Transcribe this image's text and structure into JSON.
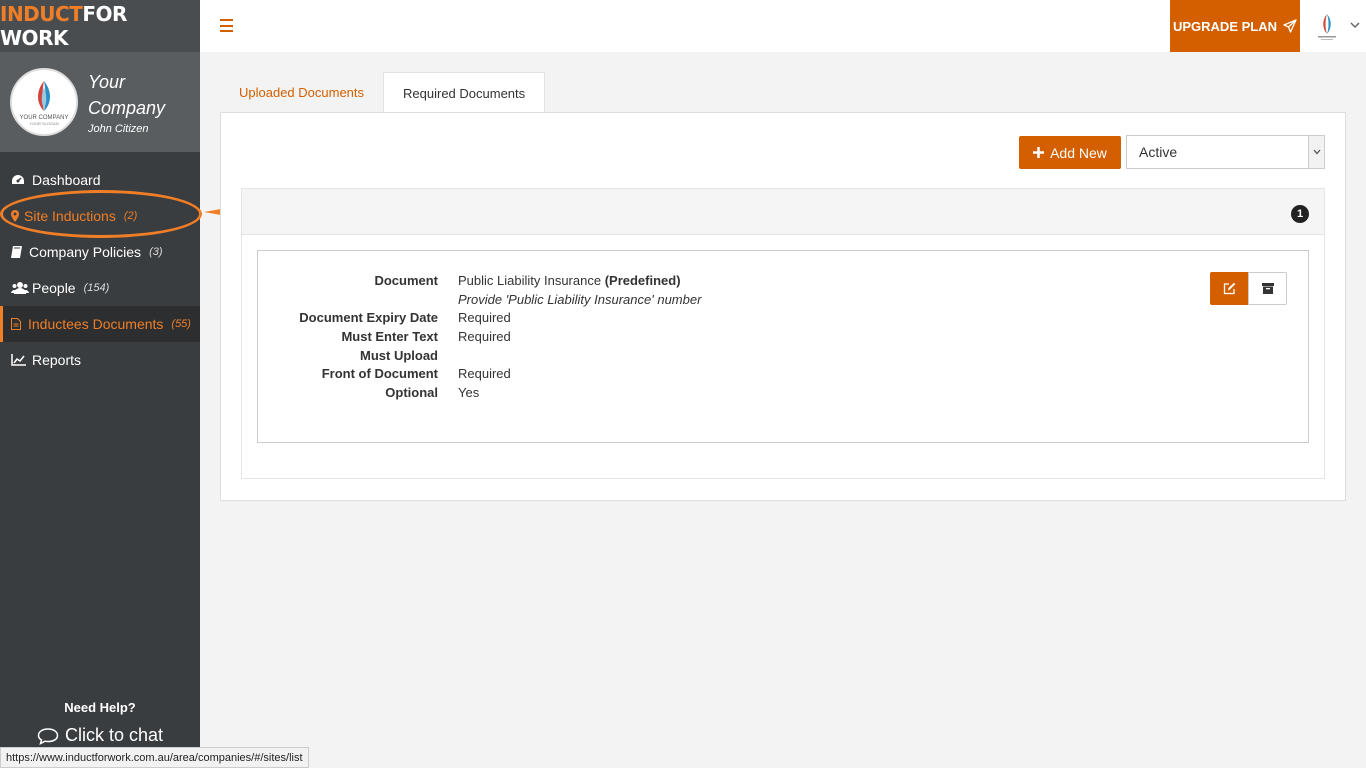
{
  "brand": {
    "part1": "INDUCT",
    "part2": "FOR WORK"
  },
  "profile": {
    "company": "Your Company",
    "user": "John Citizen",
    "logo_name": "YOUR COMPANY",
    "logo_tag": "YOUR SLOGAN"
  },
  "nav": [
    {
      "label": "Dashboard",
      "count": "",
      "icon": "dashboard-icon"
    },
    {
      "label": "Site Inductions",
      "count": "(2)",
      "icon": "map-marker-icon"
    },
    {
      "label": "Company Policies",
      "count": "(3)",
      "icon": "book-icon"
    },
    {
      "label": "People",
      "count": "(154)",
      "icon": "users-icon"
    },
    {
      "label": "Inductees Documents",
      "count": "(55)",
      "icon": "document-icon"
    },
    {
      "label": "Reports",
      "count": "",
      "icon": "line-chart-icon"
    }
  ],
  "help": {
    "title": "Need Help?",
    "chat": "Click to chat"
  },
  "topbar": {
    "upgrade": "UPGRADE PLAN"
  },
  "tabs": [
    {
      "label": "Uploaded Documents"
    },
    {
      "label": "Required Documents"
    }
  ],
  "toolbar": {
    "add_label": "Add New",
    "status_value": "Active"
  },
  "group": {
    "badge": "1"
  },
  "document": {
    "rows": [
      {
        "label": "Document",
        "value": "Public Liability Insurance",
        "value_bold": "(Predefined)"
      },
      {
        "label": "",
        "value": "Provide 'Public Liability Insurance' number"
      },
      {
        "label": "Document Expiry Date",
        "value": "Required"
      },
      {
        "label": "Must Enter Text",
        "value": "Required"
      },
      {
        "label": "Must Upload",
        "value": ""
      },
      {
        "label": "Front of Document",
        "value": "Required"
      },
      {
        "label": "Optional",
        "value": "Yes"
      }
    ]
  },
  "statusbar": {
    "url": "https://www.inductforwork.com.au/area/companies/#/sites/list"
  },
  "colors": {
    "accent": "#d35f00",
    "highlight": "#f07e26",
    "sidebar": "#3a3d3f"
  }
}
